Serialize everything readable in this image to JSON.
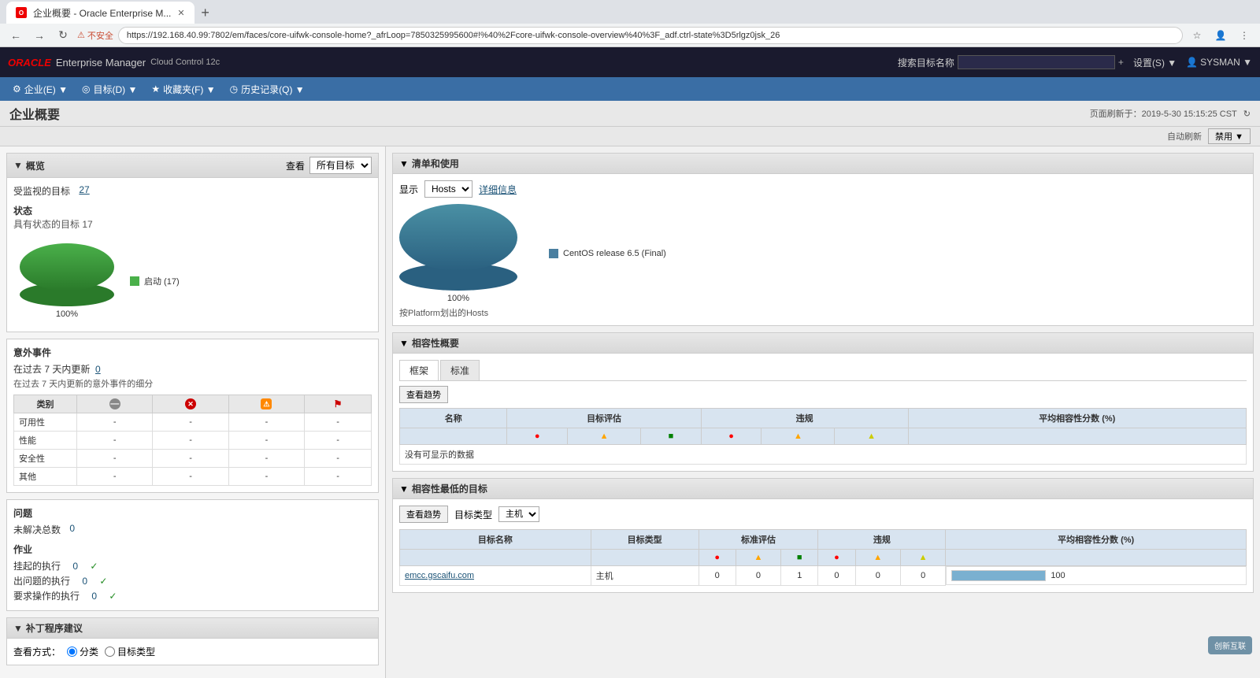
{
  "browser": {
    "tab_title": "企业概要 - Oracle Enterprise M...",
    "tab_favicon": "OEM",
    "new_tab_icon": "+",
    "nav_back": "←",
    "nav_forward": "→",
    "nav_refresh": "↻",
    "security_label": "不安全",
    "address": "https://192.168.40.99:7802/em/faces/core-uifwk-console-home?_afrLoop=7850325995600#!%40%2Fcore-uifwk-console-overview%40%3F_adf.ctrl-state%3D5rlgz0jsk_26",
    "bookmark_icon": "☆",
    "user_icon": "👤"
  },
  "app_header": {
    "oracle_text": "ORACLE",
    "em_text": "Enterprise Manager",
    "cloud_text": "Cloud Control 12c",
    "settings_label": "设置(S) ▼",
    "user_label": "SYSMAN ▼",
    "search_label": "搜索目标名称",
    "search_placeholder": "",
    "search_btn": "+"
  },
  "app_nav": {
    "items": [
      {
        "id": "enterprise",
        "icon": "⚙",
        "label": "企业(E) ▼"
      },
      {
        "id": "targets",
        "icon": "◎",
        "label": "目标(D) ▼"
      },
      {
        "id": "favorites",
        "icon": "★",
        "label": "收藏夹(F) ▼"
      },
      {
        "id": "history",
        "icon": "◷",
        "label": "历史记录(Q) ▼"
      }
    ]
  },
  "page": {
    "title": "企业概要",
    "refresh_label": "页面刷新于：2019-5-30 15:15:25 CST",
    "refresh_icon": "↻",
    "auto_refresh": "自动刷新",
    "enable_label": "禁用 ▼"
  },
  "left_panel": {
    "overview": {
      "section_title": "概览",
      "view_label": "查看",
      "view_dropdown": "所有目标",
      "monitored_label": "受监视的目标",
      "monitored_count": "27",
      "status_title": "状态",
      "status_subtitle": "具有状态的目标 17",
      "pie_percent": "100%",
      "legend": [
        {
          "color": "#4ab04a",
          "label": "启动 (17)"
        }
      ]
    },
    "incidents": {
      "title": "意外事件",
      "update_label": "在过去 7 天内更新",
      "update_count": "0",
      "subtitle": "在过去 7 天内更新的意外事件的细分",
      "columns": [
        "类别",
        "",
        "",
        "",
        ""
      ],
      "icons": [
        "-",
        "✕",
        "⚠",
        "⚑"
      ],
      "rows": [
        {
          "name": "可用性",
          "c1": "-",
          "c2": "-",
          "c3": "-",
          "c4": "-"
        },
        {
          "name": "性能",
          "c1": "-",
          "c2": "-",
          "c3": "-",
          "c4": "-"
        },
        {
          "name": "安全性",
          "c1": "-",
          "c2": "-",
          "c3": "-",
          "c4": "-"
        },
        {
          "name": "其他",
          "c1": "-",
          "c2": "-",
          "c3": "-",
          "c4": "-"
        }
      ]
    },
    "problems": {
      "title": "问题",
      "unsolved_label": "未解决总数",
      "unsolved_count": "0"
    },
    "jobs": {
      "title": "作业",
      "items": [
        {
          "label": "挂起的执行",
          "count": "0",
          "icon": "✓"
        },
        {
          "label": "出问题的执行",
          "count": "0",
          "icon": "✓"
        },
        {
          "label": "要求操作的执行",
          "count": "0",
          "icon": "✓"
        }
      ]
    },
    "patches": {
      "title": "补丁程序建议",
      "view_label": "查看方式：",
      "radio1": "分类",
      "radio2": "目标类型"
    }
  },
  "right_panel": {
    "inventory": {
      "title": "清单和使用",
      "display_label": "显示",
      "display_value": "Hosts",
      "detail_link": "详细信息",
      "pie_percent": "100%",
      "pie_bottom_label": "按Platform划出的Hosts",
      "legend": [
        {
          "color": "#4a7fa0",
          "label": "CentOS release 6.5 (Final)"
        }
      ]
    },
    "compliance": {
      "title": "相容性概要",
      "tabs": [
        "框架",
        "标准"
      ],
      "trend_btn": "查看趋势",
      "table_headers": [
        "名称",
        "目标评估",
        "",
        "",
        "",
        "",
        "违规",
        "",
        "",
        "",
        "",
        "平均相容性分数 (%)"
      ],
      "eval_icons": [
        "🔴",
        "🟡",
        "🟢",
        "🔴",
        "⚠",
        "🟡"
      ],
      "no_data": "没有可显示的数据"
    },
    "lowest_compliance": {
      "title": "相容性最低的目标",
      "trend_btn": "查看趋势",
      "target_type_label": "目标类型",
      "target_type_value": "主机",
      "table_headers": [
        "目标名称",
        "目标类型",
        "标准评估",
        "",
        "",
        "",
        "违规",
        "",
        "",
        "平均相容性分数 (%)"
      ],
      "rows": [
        {
          "name": "emcc.gscaifu.com",
          "type": "主机",
          "e1": "0",
          "e2": "0",
          "e3": "1",
          "v1": "0",
          "v2": "0",
          "v3": "0",
          "score": "100",
          "progress": 100
        }
      ]
    }
  }
}
